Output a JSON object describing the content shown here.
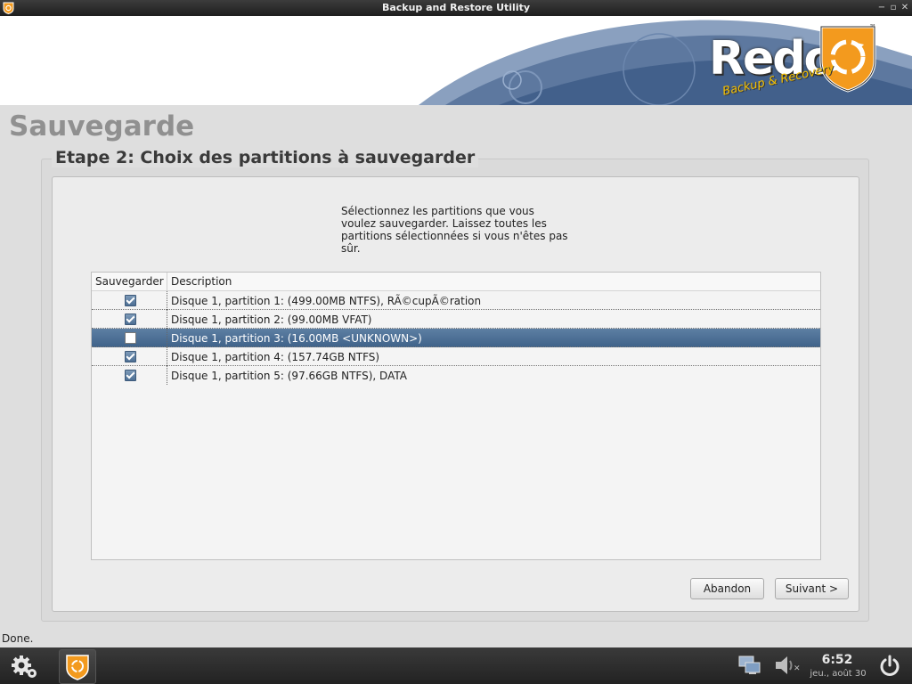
{
  "window": {
    "title": "Backup and Restore Utility",
    "minimize_glyph": "−",
    "maximize_glyph": "▫",
    "close_glyph": "✕"
  },
  "banner": {
    "logo_text": "Redo",
    "logo_tagline": "Backup & Recovery",
    "trademark": "™"
  },
  "page": {
    "title": "Sauvegarde"
  },
  "step": {
    "title": "Etape 2: Choix des partitions à sauvegarder",
    "instructions_lines": [
      "Sélectionnez les partitions que vous",
      "voulez sauvegarder. Laissez toutes les",
      "partitions sélectionnées si vous n'êtes pas",
      "sûr."
    ]
  },
  "table": {
    "columns": [
      "Sauvegarder",
      "Description"
    ],
    "rows": [
      {
        "checked": true,
        "description": "Disque 1, partition 1: (499.00MB NTFS), RÃ©cupÃ©ration",
        "selected": false
      },
      {
        "checked": true,
        "description": "Disque 1, partition 2: (99.00MB VFAT)",
        "selected": false
      },
      {
        "checked": false,
        "description": "Disque 1, partition 3: (16.00MB <UNKNOWN>)",
        "selected": true
      },
      {
        "checked": true,
        "description": "Disque 1, partition 4: (157.74GB NTFS)",
        "selected": false
      },
      {
        "checked": true,
        "description": "Disque 1, partition 5: (97.66GB NTFS), DATA",
        "selected": false
      }
    ]
  },
  "buttons": {
    "cancel": "Abandon",
    "next": "Suivant >"
  },
  "status": "Done.",
  "taskbar": {
    "time": "6:52",
    "date": "jeu., août 30"
  },
  "colors": {
    "accent": "#3f6289",
    "logo_orange": "#f39a1e",
    "banner_blue": "#4a6a94"
  }
}
